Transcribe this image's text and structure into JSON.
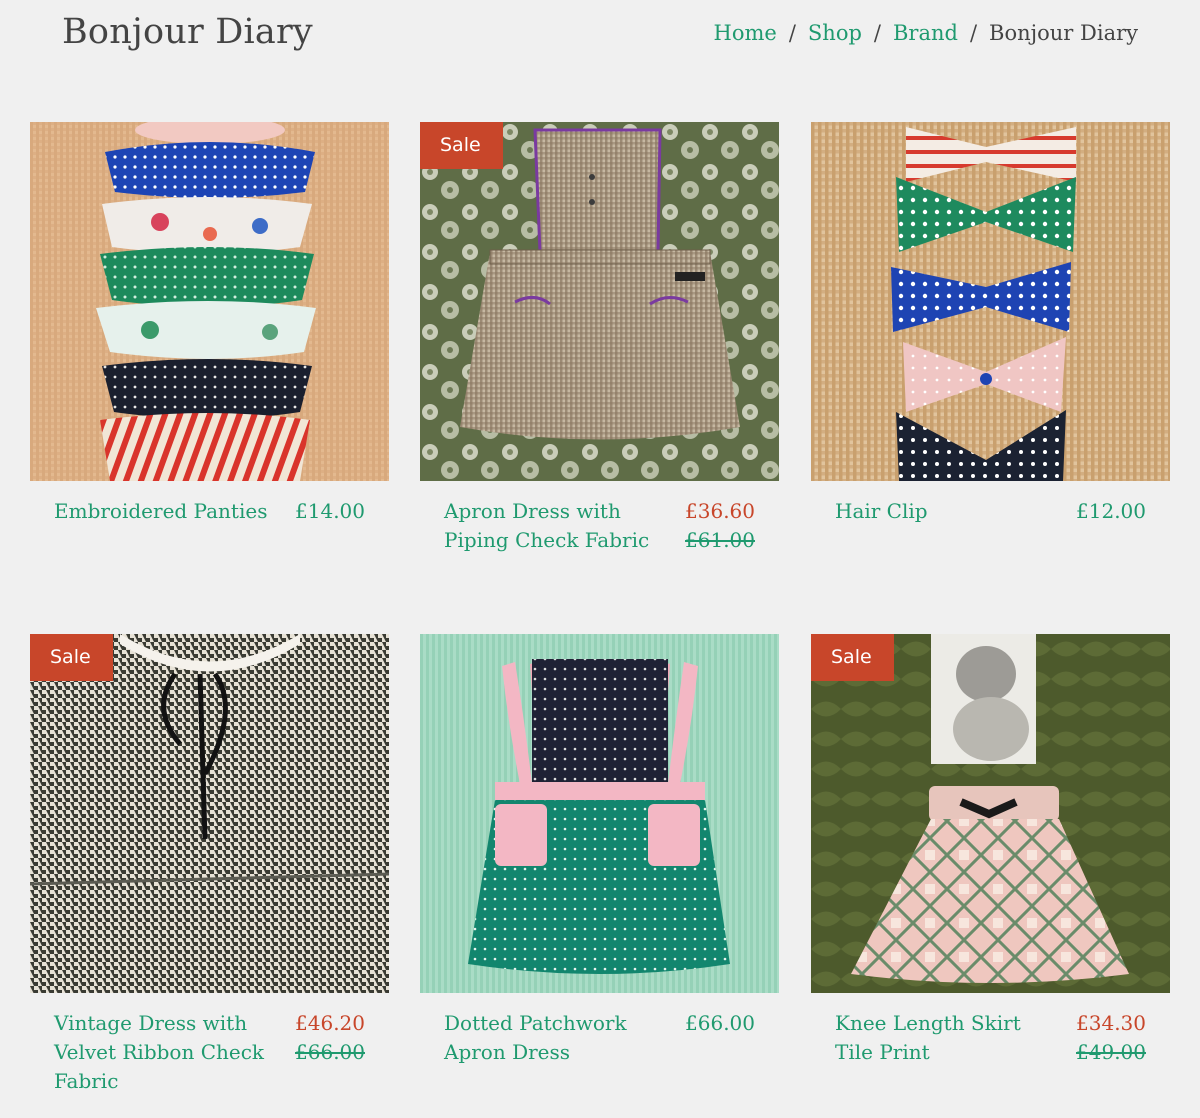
{
  "header": {
    "title": "Bonjour Diary",
    "breadcrumb": {
      "home": "Home",
      "shop": "Shop",
      "brand": "Brand",
      "current": "Bonjour Diary",
      "separator": "/"
    }
  },
  "colors": {
    "accent": "#1f9a6f",
    "sale": "#c8462a",
    "background": "#f0f0f0"
  },
  "products": [
    {
      "name": "Embroidered Panties",
      "price": "£14.00",
      "sale": false,
      "badge": "",
      "old_price": ""
    },
    {
      "name": "Apron Dress with Piping Check Fabric",
      "price": "£36.60",
      "old_price": "£61.00",
      "sale": true,
      "badge": "Sale"
    },
    {
      "name": "Hair Clip",
      "price": "£12.00",
      "sale": false,
      "badge": "",
      "old_price": ""
    },
    {
      "name": "Vintage Dress with Velvet Ribbon Check Fabric",
      "price": "£46.20",
      "old_price": "£66.00",
      "sale": true,
      "badge": "Sale"
    },
    {
      "name": "Dotted Patchwork Apron Dress",
      "price": "£66.00",
      "sale": false,
      "badge": "",
      "old_price": ""
    },
    {
      "name": "Knee Length Skirt Tile Print",
      "price": "£34.30",
      "old_price": "£49.00",
      "sale": true,
      "badge": "Sale"
    }
  ]
}
